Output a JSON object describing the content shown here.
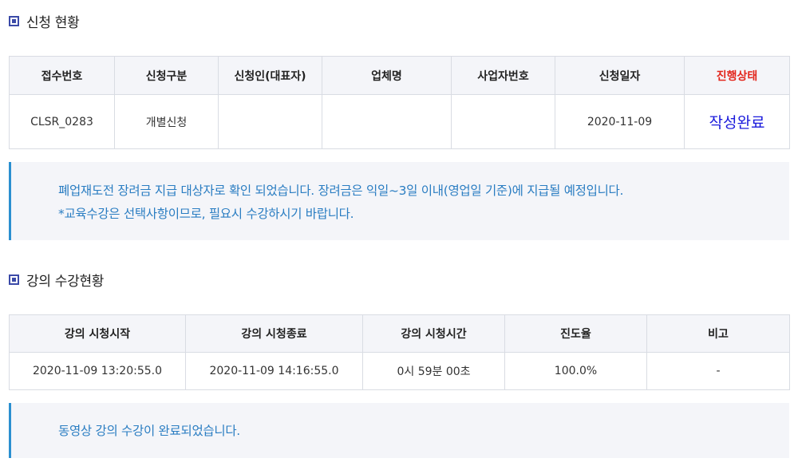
{
  "application_section": {
    "title": "신청 현황",
    "headers": [
      "접수번호",
      "신청구분",
      "신청인(대표자)",
      "업체명",
      "사업자번호",
      "신청일자",
      "진행상태"
    ],
    "row": {
      "receipt_no": "CLSR_0283",
      "type": "개별신청",
      "applicant": "",
      "company": "",
      "business_no": "",
      "date": "2020-11-09",
      "status": "작성완료"
    },
    "status_head_color": "#e3261c",
    "status_value_color": "#1a1adc"
  },
  "notice_application": {
    "lines": [
      "폐업재도전 장려금 지급 대상자로 확인 되었습니다. 장려금은 익일~3일 이내(영업일 기준)에 지급될 예정입니다.",
      "*교육수강은 선택사항이므로, 필요시 수강하시기 바랍니다."
    ]
  },
  "lecture_section": {
    "title": "강의 수강현황",
    "headers": [
      "강의 시청시작",
      "강의 시청종료",
      "강의 시청시간",
      "진도율",
      "비고"
    ],
    "row": {
      "start": "2020-11-09 13:20:55.0",
      "end": "2020-11-09 14:16:55.0",
      "duration": "0시 59분 00초",
      "progress": "100.0%",
      "note": "-"
    }
  },
  "notice_lecture": {
    "lines": [
      "동영상 강의 수강이 완료되었습니다."
    ]
  },
  "colors": {
    "accent_blue": "#2a8fd0",
    "bullet": "#3b4aa8",
    "header_bg": "#f4f5f9"
  }
}
